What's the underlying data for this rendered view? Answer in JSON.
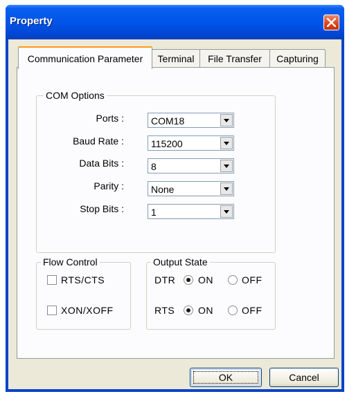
{
  "window": {
    "title": "Property"
  },
  "tabs": [
    {
      "label": "Communication Parameter"
    },
    {
      "label": "Terminal"
    },
    {
      "label": "File Transfer"
    },
    {
      "label": "Capturing"
    }
  ],
  "com_options": {
    "legend": "COM Options",
    "fields": [
      {
        "label": "Ports :",
        "value": "COM18"
      },
      {
        "label": "Baud Rate :",
        "value": "115200"
      },
      {
        "label": "Data Bits :",
        "value": "8"
      },
      {
        "label": "Parity :",
        "value": "None"
      },
      {
        "label": "Stop Bits :",
        "value": "1"
      }
    ]
  },
  "flow_control": {
    "legend": "Flow Control",
    "rts_cts": {
      "label": "RTS/CTS",
      "checked": false
    },
    "xon_xoff": {
      "label": "XON/XOFF",
      "checked": false
    }
  },
  "output_state": {
    "legend": "Output State",
    "dtr": {
      "label": "DTR",
      "on": "ON",
      "off": "OFF",
      "selected": "ON"
    },
    "rts": {
      "label": "RTS",
      "on": "ON",
      "off": "OFF",
      "selected": "ON"
    }
  },
  "buttons": {
    "ok": "OK",
    "cancel": "Cancel"
  }
}
